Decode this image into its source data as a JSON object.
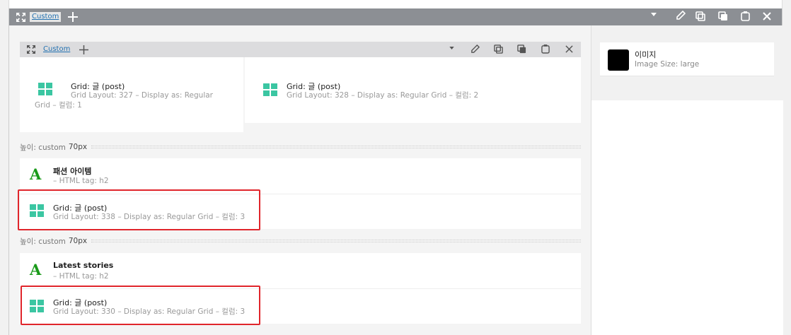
{
  "outer_bar": {
    "tab_label": "Custom",
    "icons": [
      "expand-icon",
      "plus-icon",
      "caret-down-icon",
      "pencil-icon",
      "duplicate-icon",
      "copy-icon",
      "paste-icon",
      "close-icon"
    ],
    "bg_color": "#8c8f94"
  },
  "inner_bar": {
    "tab_label": "Custom"
  },
  "grid_cards": [
    {
      "title": "Grid: 글 (post)",
      "subtitle": "Grid Layout: 327 – Display as: Regular Grid – 컬럼: 1"
    },
    {
      "title": "Grid: 글 (post)",
      "subtitle": "Grid Layout: 328 – Display as: Regular Grid – 컬럼: 2"
    }
  ],
  "spacers": [
    {
      "label": "높이: custom",
      "value": "70px"
    },
    {
      "label": "높이: custom",
      "value": "70px"
    }
  ],
  "sections": [
    {
      "heading": {
        "title": "패션 아이템",
        "subtitle": "– HTML tag: h2"
      },
      "grid": {
        "title": "Grid: 글 (post)",
        "subtitle": "Grid Layout: 338 – Display as: Regular Grid – 컬럼: 3"
      }
    },
    {
      "heading": {
        "title": "Latest stories",
        "subtitle": "– HTML tag: h2"
      },
      "grid": {
        "title": "Grid: 글 (post)",
        "subtitle": "Grid Layout: 330 – Display as: Regular Grid – 컬럼: 3"
      }
    }
  ],
  "image_widget": {
    "title": "이미지",
    "subtitle": "Image Size: large"
  },
  "colors": {
    "accent": "#2271b1",
    "grid_icon": "#3bc6a2",
    "heading_icon": "#1a9a1a",
    "highlight": "#e0252b"
  }
}
